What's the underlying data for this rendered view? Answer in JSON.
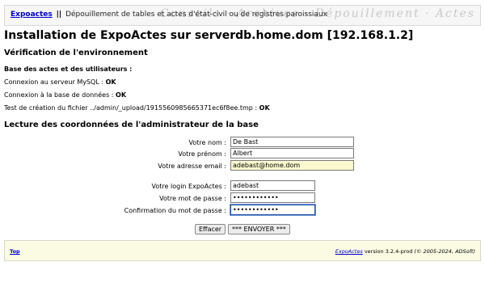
{
  "header": {
    "app_link": "Expoactes",
    "separator": "||",
    "description": "Dépouillement de tables et actes d'état-civil ou de registres paroissiaux",
    "background_script": "Conseils · Archives · Dépouillement · Actes"
  },
  "page": {
    "title": "Installation de ExpoActes sur serverdb.home.dom [192.168.1.2]"
  },
  "env_check": {
    "heading": "Vérification de l'environnement",
    "subheading": "Base des actes et des utilisateurs :",
    "checks": [
      {
        "label": "Connexion au serveur MySQL : ",
        "value": "OK"
      },
      {
        "label": "Connexion à la base de données : ",
        "value": "OK"
      },
      {
        "label": "Test de création du fichier ../admin/_upload/1915560985665371ec6f8ee.tmp : ",
        "value": "OK"
      }
    ]
  },
  "admin_form": {
    "heading": "Lecture des coordonnées de l'administrateur de la base",
    "fields": {
      "nom": {
        "label": "Votre nom :",
        "value": "De Bast"
      },
      "prenom": {
        "label": "Votre prénom :",
        "value": "Albert"
      },
      "email": {
        "label": "Votre adresse email :",
        "value": "adebast@home.dom"
      },
      "login": {
        "label": "Votre login ExpoActes :",
        "value": "adebast"
      },
      "password": {
        "label": "Votre mot de passe :",
        "value": "••••••••••••"
      },
      "password_confirm": {
        "label": "Confirmation du mot de passe :",
        "value": "••••••••••••"
      }
    },
    "buttons": {
      "reset": "Effacer",
      "submit": "*** ENVOYER ***"
    }
  },
  "footer": {
    "top_link": "Top",
    "app_link": "ExpoActes",
    "version_text": " version 3.2.4-prod ",
    "copyright": "(© 2005-2024, ADSoft)"
  },
  "colors": {
    "link": "#0000cc",
    "footer_bg": "#fbfbe3",
    "autofill_bg": "#fbf9cf",
    "focus_border": "#1d4fa0"
  }
}
